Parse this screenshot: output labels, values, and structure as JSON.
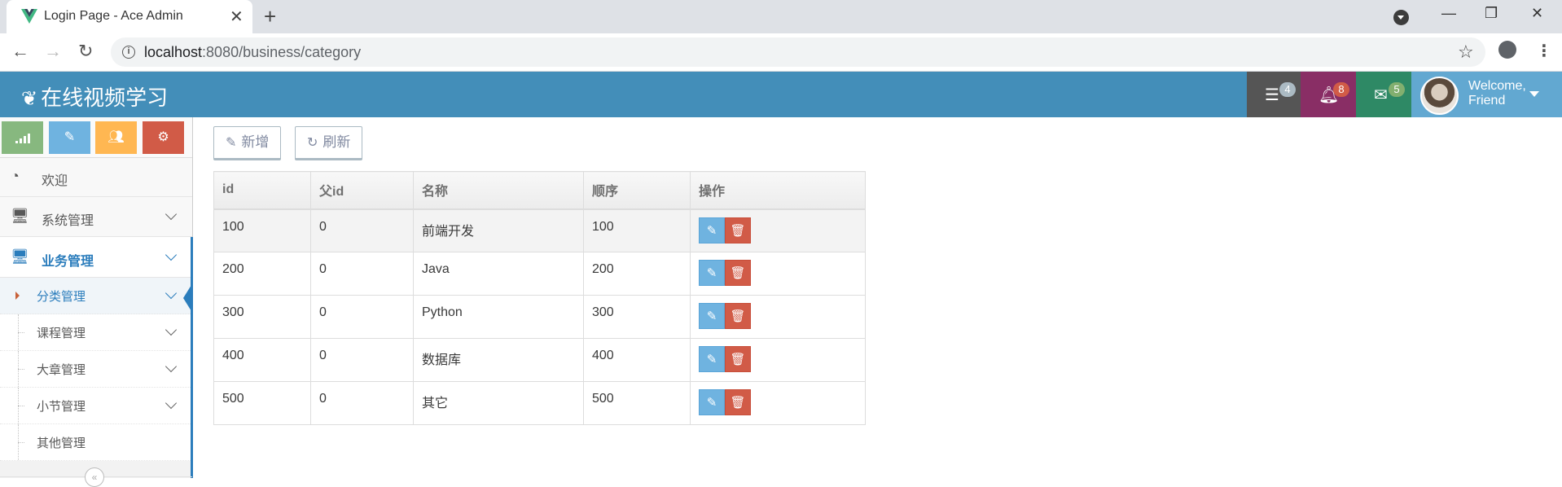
{
  "browser": {
    "tab_title": "Login Page - Ace Admin",
    "url_host": "localhost",
    "url_path": ":8080/business/category",
    "icons": [
      "vue-favicon-icon",
      "close-icon",
      "plus-icon",
      "minimize-icon",
      "restore-icon",
      "close-window-icon",
      "back-icon",
      "forward-icon",
      "reload-icon",
      "info-icon",
      "star-icon",
      "account-icon",
      "kebab-icon"
    ]
  },
  "navbar": {
    "brand": "在线视频学习",
    "tasks_count": "4",
    "notifications_count": "8",
    "messages_count": "5",
    "user_welcome": "Welcome,",
    "user_name": "Friend",
    "colors": {
      "bar": "#438eb9",
      "tasks": "#555555",
      "notifications": "#892e65",
      "messages": "#2e8965",
      "user": "#62a8d1"
    }
  },
  "sidebar": {
    "shortcuts": [
      {
        "icon": "signal-icon",
        "color": "#87b87f"
      },
      {
        "icon": "pencil-icon",
        "color": "#6fb3e0"
      },
      {
        "icon": "users-icon",
        "color": "#ffb752"
      },
      {
        "icon": "cogs-icon",
        "color": "#d15b47"
      }
    ],
    "items": [
      {
        "label": "欢迎"
      },
      {
        "label": "系统管理"
      },
      {
        "label": "业务管理"
      }
    ],
    "sub_items": [
      {
        "label": "分类管理"
      },
      {
        "label": "课程管理"
      },
      {
        "label": "大章管理"
      },
      {
        "label": "小节管理"
      },
      {
        "label": "其他管理"
      }
    ],
    "collapse_icon": "double-chevron-left-icon"
  },
  "toolbar": {
    "add_label": "新增",
    "refresh_label": "刷新"
  },
  "table": {
    "headers": [
      "id",
      "父id",
      "名称",
      "顺序",
      "操作"
    ],
    "rows": [
      {
        "id": "100",
        "parent": "0",
        "name": "前端开发",
        "sort": "100"
      },
      {
        "id": "200",
        "parent": "0",
        "name": "Java",
        "sort": "200"
      },
      {
        "id": "300",
        "parent": "0",
        "name": "Python",
        "sort": "300"
      },
      {
        "id": "400",
        "parent": "0",
        "name": "数据库",
        "sort": "400"
      },
      {
        "id": "500",
        "parent": "0",
        "name": "其它",
        "sort": "500"
      }
    ]
  }
}
